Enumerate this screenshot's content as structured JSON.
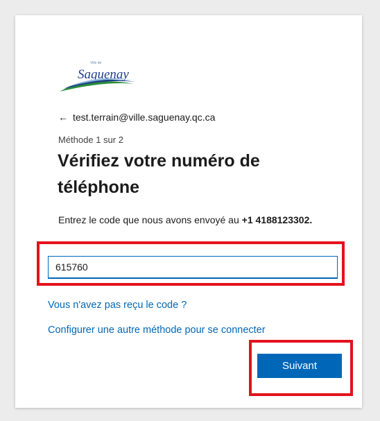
{
  "brand": {
    "logo_text": "Saguenay",
    "logo_small_text": "Ville de"
  },
  "account": {
    "back_icon": "arrow-left-icon",
    "email": "test.terrain@ville.saguenay.qc.ca"
  },
  "form": {
    "method_label": "Méthode 1 sur 2",
    "title": "Vérifiez votre numéro de téléphone",
    "description_prefix": "Entrez le code que nous avons envoyé au ",
    "phone_number": "+1 4188123302",
    "description_suffix": ".",
    "code_value": "615760"
  },
  "links": {
    "no_code": "Vous n'avez pas reçu le code ?",
    "other_method": "Configurer une autre méthode pour se connecter"
  },
  "actions": {
    "next_label": "Suivant"
  },
  "colors": {
    "accent": "#0067b8",
    "highlight": "#e4121c",
    "background": "#ececec"
  }
}
